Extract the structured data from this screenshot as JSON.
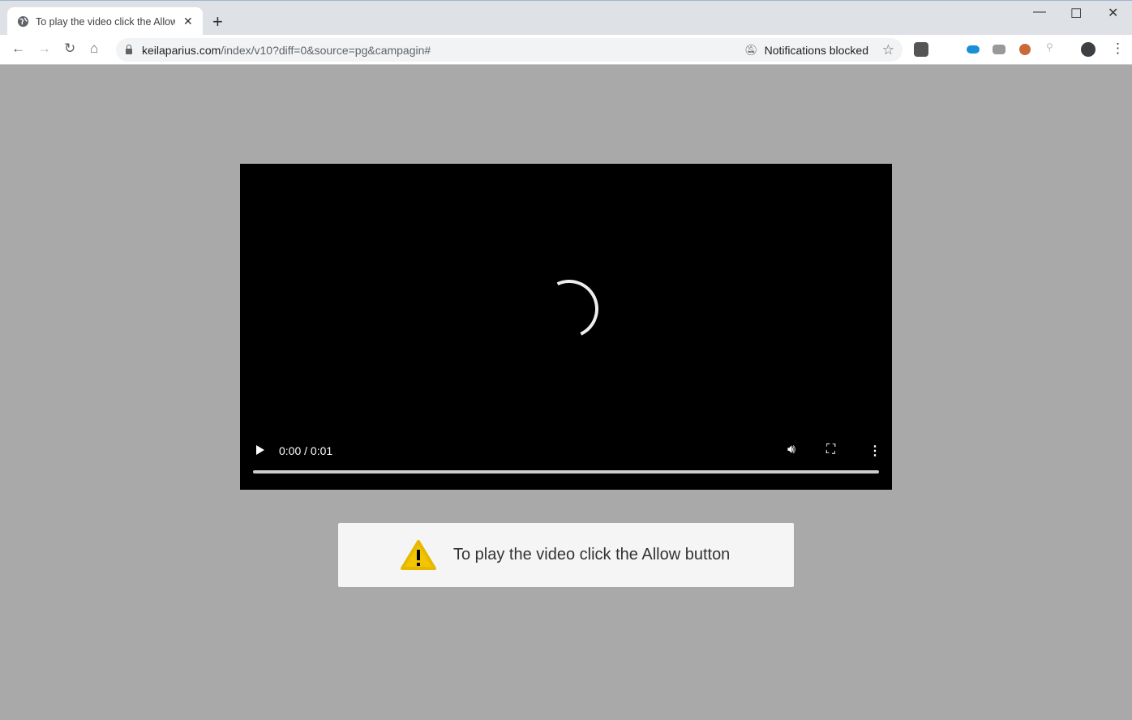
{
  "browser": {
    "tab_title": "To play the video click the Allow button",
    "url_domain": "keilaparius.com",
    "url_path": "/index/v10?diff=0&source=pg&campagin#",
    "notifications_label": "Notifications blocked"
  },
  "video": {
    "time": "0:00 / 0:01",
    "progress": 0
  },
  "message": {
    "text": "To play the video click the Allow button",
    "icon": "warning-icon",
    "icon_color": "#f2c500"
  }
}
